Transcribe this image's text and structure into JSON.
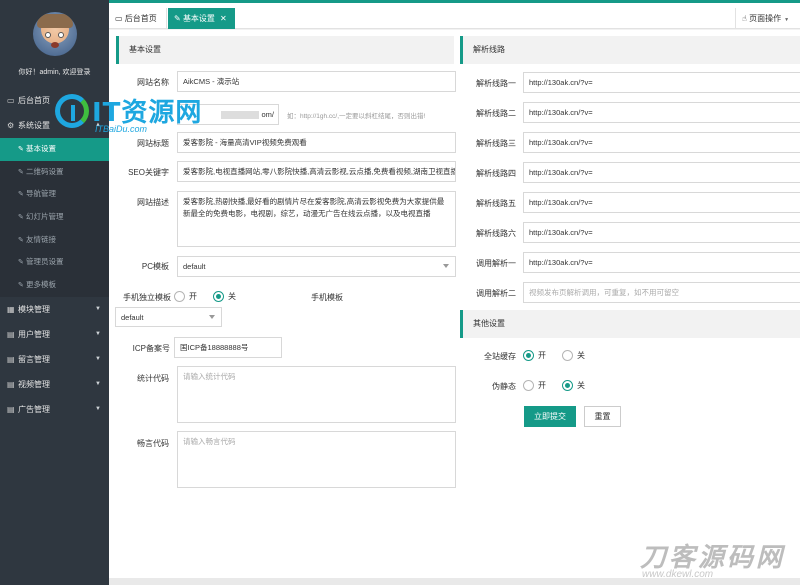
{
  "sidebar": {
    "greeting": "你好！admin, 欢迎登录",
    "items": [
      {
        "label": "后台首页",
        "icon": "monitor-icon"
      },
      {
        "label": "系统设置",
        "icon": "gear-icon"
      },
      {
        "label": "模块管理",
        "icon": "grid-icon"
      },
      {
        "label": "用户管理",
        "icon": "user-icon"
      },
      {
        "label": "留言管理",
        "icon": "message-icon"
      },
      {
        "label": "视频管理",
        "icon": "video-icon"
      },
      {
        "label": "广告管理",
        "icon": "ad-icon"
      }
    ],
    "subitems": [
      {
        "label": "基本设置"
      },
      {
        "label": "二维码设置"
      },
      {
        "label": "导航管理"
      },
      {
        "label": "幻灯片管理"
      },
      {
        "label": "友情链接"
      },
      {
        "label": "管理员设置"
      },
      {
        "label": "更多模板"
      }
    ]
  },
  "topbar": {
    "tab_home": "后台首页",
    "tab_active": "基本设置",
    "page_ops": "页面操作"
  },
  "basic": {
    "section_title": "基本设置",
    "site_name_label": "网站名称",
    "site_name": "AikCMS - 演示站",
    "site_url_tail": "om/",
    "site_url_hint": "如：http://1gh.cc/,一定要以斜杠结尾，否则出错!",
    "site_title_label": "网站标题",
    "site_title": "爱客影院 - 海量高清VIP视频免费观看",
    "seo_label": "SEO关键字",
    "seo": "爱客影院,电视直播网站,零八影院快播,高清云影视,云点播,免费看视频,湖南卫视直播",
    "desc_label": "网站描述",
    "desc": "爱客影院,热剧快播,最好看的剧情片尽在爱客影院,高清云影视免费为大家提供最新最全的免费电影，电视剧，综艺，动漫无广告在线云点播，以及电视直播",
    "pc_tpl_label": "PC模板",
    "pc_tpl": "default",
    "mobile_tpl_label": "手机独立模板",
    "on": "开",
    "off": "关",
    "mobile_tpl2_label": "手机模板",
    "mobile_tpl": "default",
    "icp_label": "ICP备案号",
    "icp": "国ICP备18888888号",
    "stats_label": "统计代码",
    "stats_ph": "请输入统计代码",
    "comment_label": "畅言代码",
    "comment_ph": "请输入畅言代码"
  },
  "parse": {
    "section_title": "解析线路",
    "lines": [
      {
        "label": "解析线路一",
        "value": "http://130ak.cn/?v="
      },
      {
        "label": "解析线路二",
        "value": "http://130ak.cn/?v="
      },
      {
        "label": "解析线路三",
        "value": "http://130ak.cn/?v="
      },
      {
        "label": "解析线路四",
        "value": "http://130ak.cn/?v="
      },
      {
        "label": "解析线路五",
        "value": "http://130ak.cn/?v="
      },
      {
        "label": "解析线路六",
        "value": "http://130ak.cn/?v="
      },
      {
        "label": "调用解析一",
        "value": "http://130ak.cn/?v="
      }
    ],
    "call2_label": "调用解析二",
    "call2_ph": "视频发布页解析调用，可重复，如不用可留空"
  },
  "other": {
    "section_title": "其他设置",
    "cache_label": "全站缓存",
    "static_label": "伪静态",
    "on": "开",
    "off": "关",
    "submit": "立即提交",
    "reset": "重置"
  },
  "watermarks": {
    "logo_big": "IT资源网",
    "logo_small": "ITBaiDu.com",
    "corner_big": "刀客源码网",
    "corner_small": "www.dkewl.com"
  },
  "colors": {
    "accent": "#159a88",
    "sidebar": "#2f3740"
  }
}
